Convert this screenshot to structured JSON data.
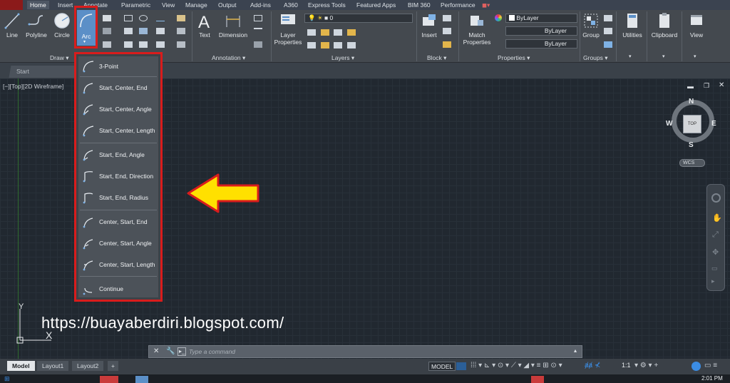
{
  "menu_tabs": [
    "Home",
    "Insert",
    "Annotate",
    "Parametric",
    "View",
    "Manage",
    "Output",
    "Add-ins",
    "A360",
    "Express Tools",
    "Featured Apps",
    "BIM 360",
    "Performance"
  ],
  "ribbon": {
    "draw_tools": [
      "Line",
      "Polyline",
      "Circle",
      "Arc"
    ],
    "annotation_tools": [
      "Text",
      "Dimension"
    ],
    "layer_tools": [
      "Layer Properties"
    ],
    "layer_combo": "0",
    "block_tools": [
      "Insert"
    ],
    "properties_tools": [
      "Match Properties"
    ],
    "properties_combos": [
      "ByLayer",
      "ByLayer",
      "ByLayer"
    ],
    "group_tools": [
      "Group"
    ],
    "right_tools": [
      "Utilities",
      "Clipboard",
      "View"
    ],
    "panel_titles": {
      "draw": "Draw ▾",
      "annotation": "Annotation ▾",
      "layers": "Layers ▾",
      "block": "Block ▾",
      "properties": "Properties ▾",
      "groups": "Groups ▾"
    }
  },
  "file_tab": "Start",
  "viewport_label": "[−][Top][2D Wireframe]",
  "arc_menu": {
    "items": [
      {
        "label": "3-Point"
      },
      {
        "label": "Start, Center, End"
      },
      {
        "label": "Start, Center, Angle"
      },
      {
        "label": "Start, Center, Length"
      },
      {
        "label": "Start, End, Angle"
      },
      {
        "label": "Start, End, Direction"
      },
      {
        "label": "Start, End, Radius"
      },
      {
        "label": "Center, Start, End"
      },
      {
        "label": "Center, Start, Angle"
      },
      {
        "label": "Center, Start, Length"
      },
      {
        "label": "Continue"
      }
    ]
  },
  "watermark_url": "https://buayaberdiri.blogspot.com/",
  "viewcube": {
    "top": "TOP",
    "n": "N",
    "s": "S",
    "e": "E",
    "w": "W",
    "wcs": "WCS"
  },
  "ucs": {
    "x": "X",
    "y": "Y"
  },
  "command_line": {
    "placeholder": "Type a command",
    "prompt": "▸_"
  },
  "layout_tabs": [
    "Model",
    "Layout1",
    "Layout2",
    "+"
  ],
  "status": {
    "model": "MODEL",
    "scale": "1:1",
    "time": "2:01 PM"
  },
  "colors": {
    "highlight_border": "#d91c1c",
    "arrow_fill": "#ffe000",
    "arrow_stroke": "#d91c1c",
    "ribbon_bg": "#44494f",
    "canvas_bg": "#212830",
    "arc_button_bg": "#5b8fc7"
  }
}
